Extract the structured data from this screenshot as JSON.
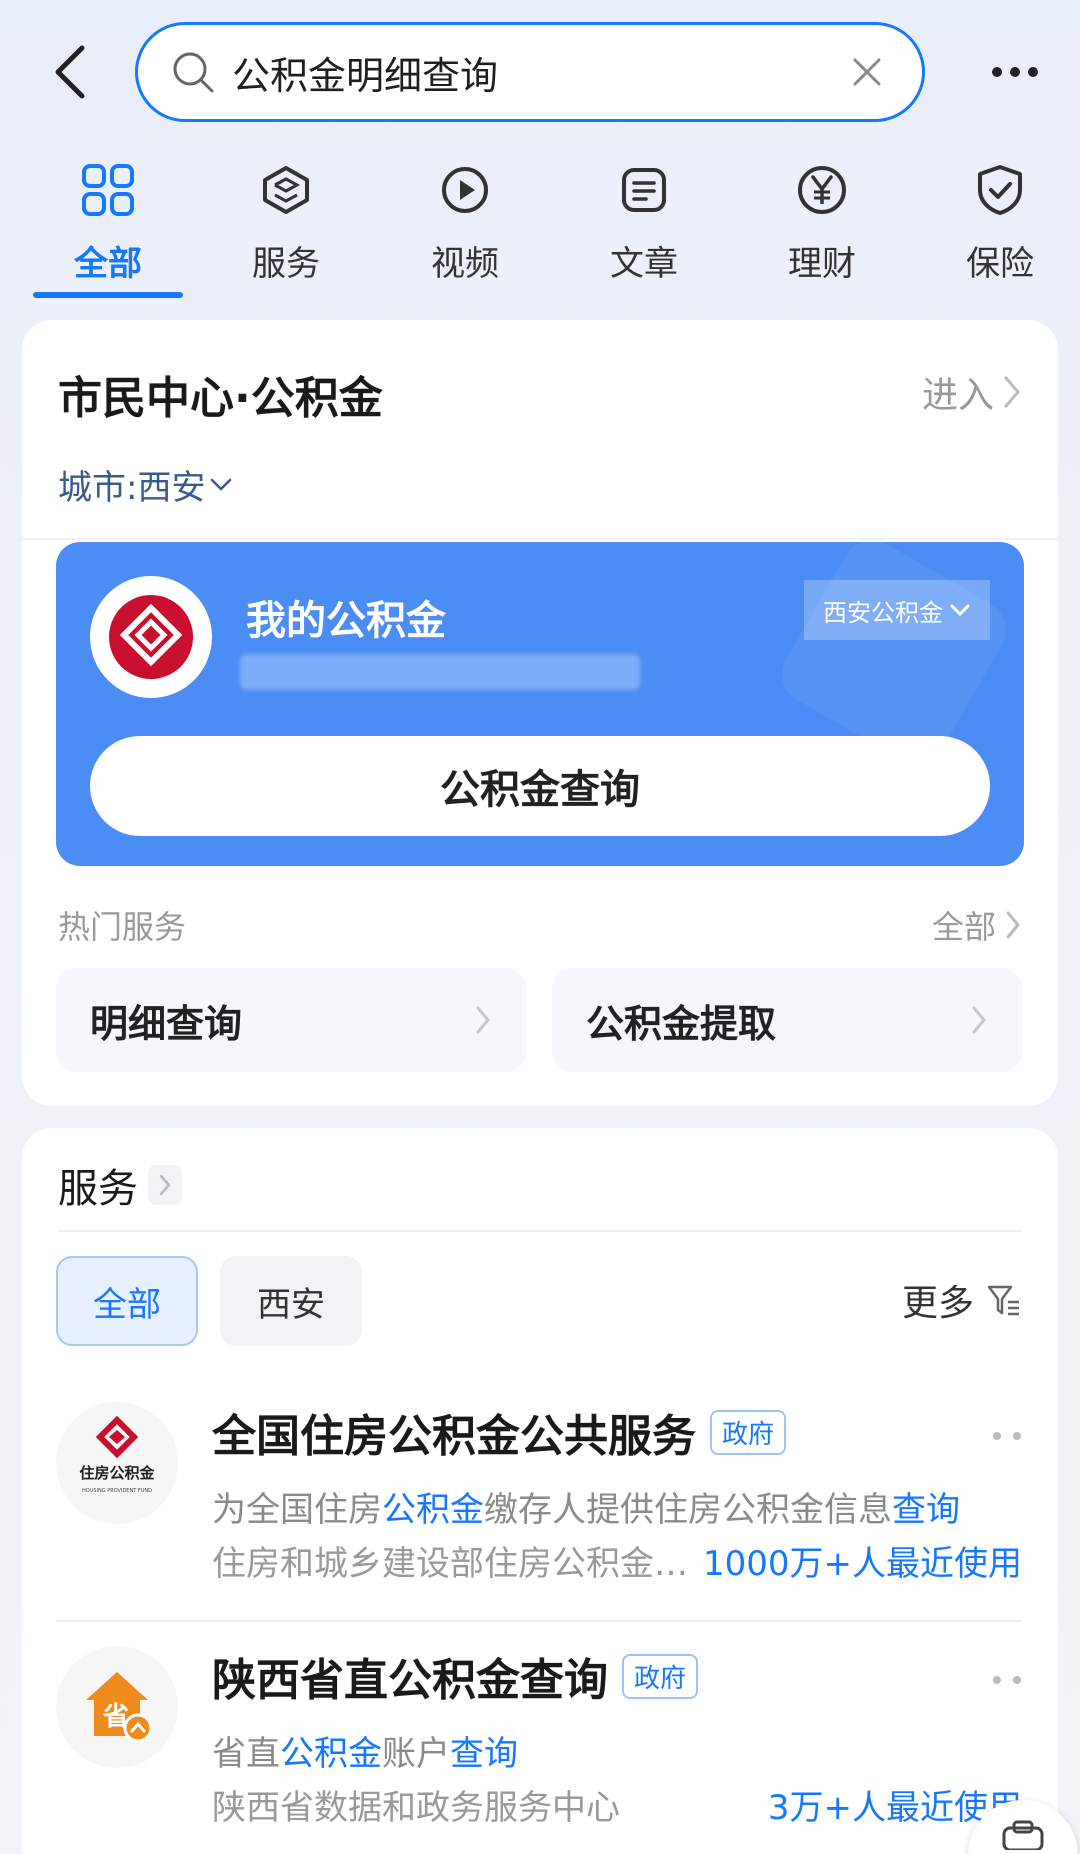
{
  "search": {
    "query": "公积金明细查询"
  },
  "tabs": [
    {
      "label": "全部",
      "icon": "grid-icon"
    },
    {
      "label": "服务",
      "icon": "cube-icon"
    },
    {
      "label": "视频",
      "icon": "play-icon"
    },
    {
      "label": "文章",
      "icon": "article-icon"
    },
    {
      "label": "理财",
      "icon": "yen-icon"
    },
    {
      "label": "保险",
      "icon": "shield-check-icon"
    }
  ],
  "card1": {
    "title": "市民中心·公积金",
    "enter_label": "进入",
    "city_label": "城市:西安",
    "fund": {
      "title": "我的公积金",
      "selector": "西安公积金",
      "query_button": "公积金查询"
    },
    "hot": {
      "title": "热门服务",
      "all_label": "全部",
      "items": [
        "明细查询",
        "公积金提取"
      ]
    }
  },
  "services": {
    "title": "服务",
    "filters": {
      "all": "全部",
      "xian": "西安",
      "more": "更多"
    },
    "items": [
      {
        "name": "全国住房公积金公共服务",
        "tag": "政府",
        "desc_parts": [
          "为全国住房",
          "公积金",
          "缴存人提供住房公积金信息",
          "查询"
        ],
        "org": "住房和城乡建设部住房公积金监管司",
        "users": "1000万+人最近使用",
        "logo_text": "住房公积金",
        "logo_subtext": "HOUSING PROVIDENT FUND"
      },
      {
        "name": "陕西省直公积金查询",
        "tag": "政府",
        "desc_parts": [
          "省直",
          "公积金",
          "账户",
          "查询"
        ],
        "org": "陕西省数据和政务服务中心",
        "users": "3万+人最近使用",
        "logo_text": "省"
      }
    ]
  },
  "colors": {
    "accent": "#1677ff",
    "panel": "#4b8df5",
    "logo_red": "#c8102e",
    "logo_orange": "#f08a1c"
  }
}
